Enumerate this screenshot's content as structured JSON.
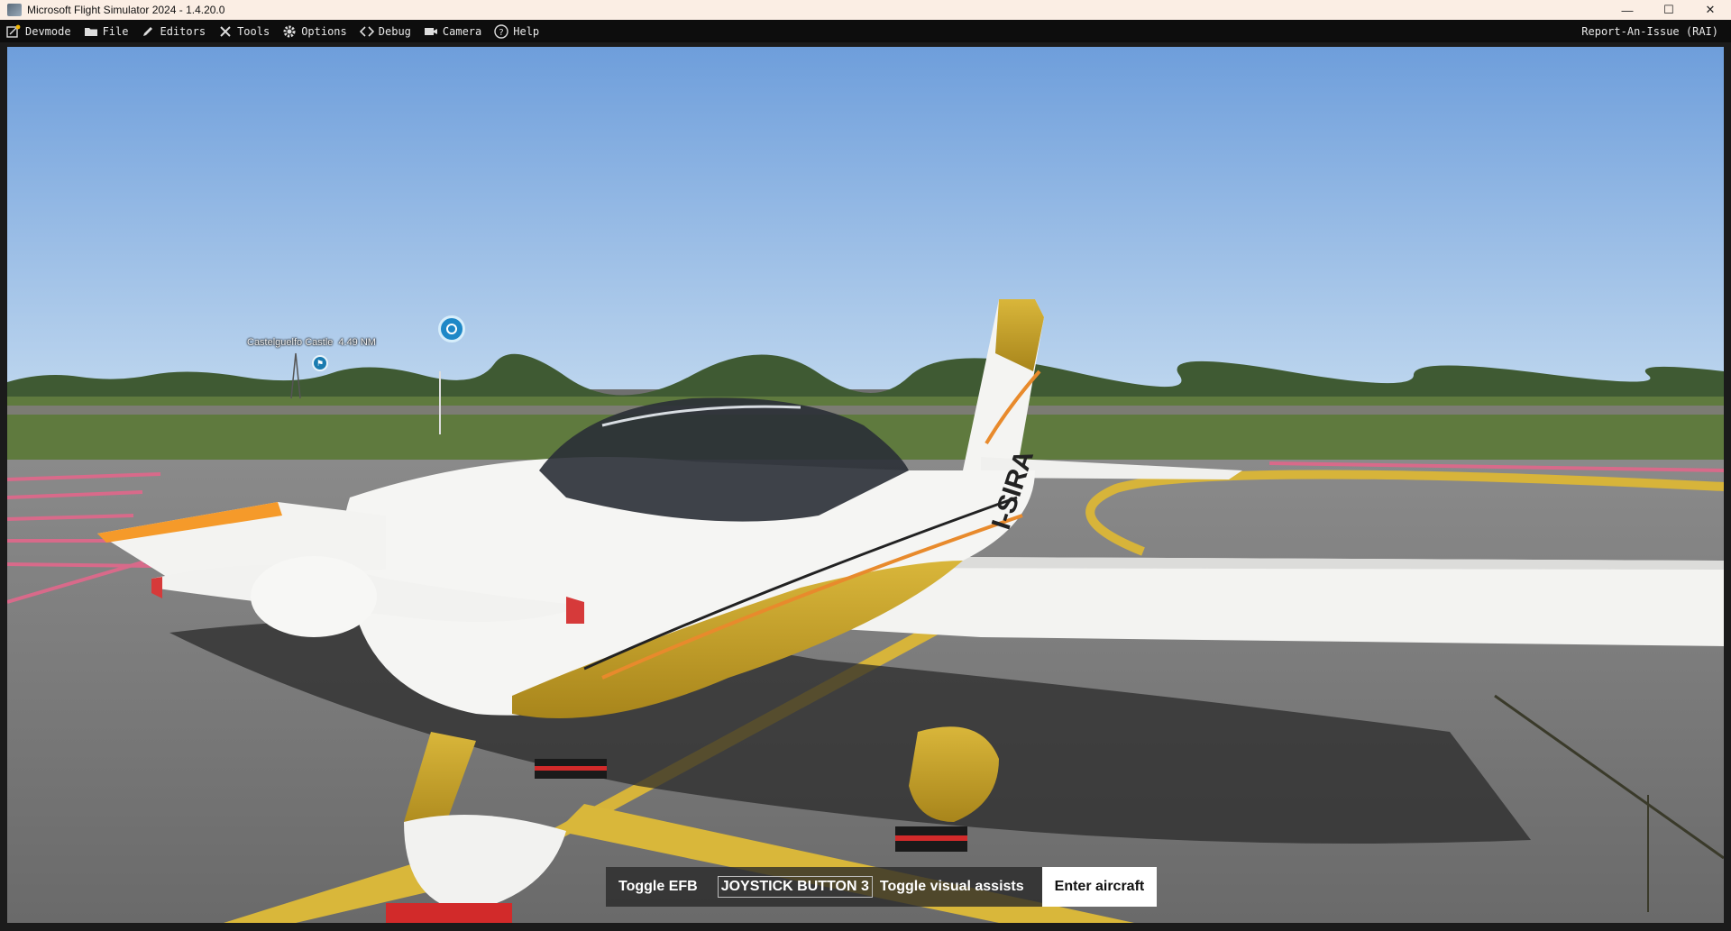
{
  "window": {
    "title": "Microsoft Flight Simulator 2024 - 1.4.20.0",
    "minimize": "—",
    "maximize": "☐",
    "close": "✕"
  },
  "menubar": {
    "items": [
      {
        "label": "Devmode",
        "icon": "devmode-icon"
      },
      {
        "label": "File",
        "icon": "folder-icon"
      },
      {
        "label": "Editors",
        "icon": "pencil-icon"
      },
      {
        "label": "Tools",
        "icon": "tools-icon"
      },
      {
        "label": "Options",
        "icon": "gear-icon"
      },
      {
        "label": "Debug",
        "icon": "code-icon"
      },
      {
        "label": "Camera",
        "icon": "camera-icon"
      },
      {
        "label": "Help",
        "icon": "help-icon"
      }
    ],
    "report": "Report-An-Issue (RAI)"
  },
  "scene": {
    "poi_name": "Castelguelfo Castle",
    "poi_distance": "4.49 NM",
    "registration": "I-SIRA"
  },
  "prompts": {
    "toggle_efb": "Toggle EFB",
    "key": "JOYSTICK BUTTON 3",
    "toggle_assists": "Toggle visual assists",
    "enter_aircraft": "Enter aircraft"
  },
  "colors": {
    "sky_top": "#6f9fdc",
    "sky_bottom": "#b8d3ee",
    "tarmac": "#7a7a7a",
    "grass": "#5f7a3e",
    "aircraft_white": "#f4f4f2",
    "aircraft_gold": "#c9a22a"
  }
}
